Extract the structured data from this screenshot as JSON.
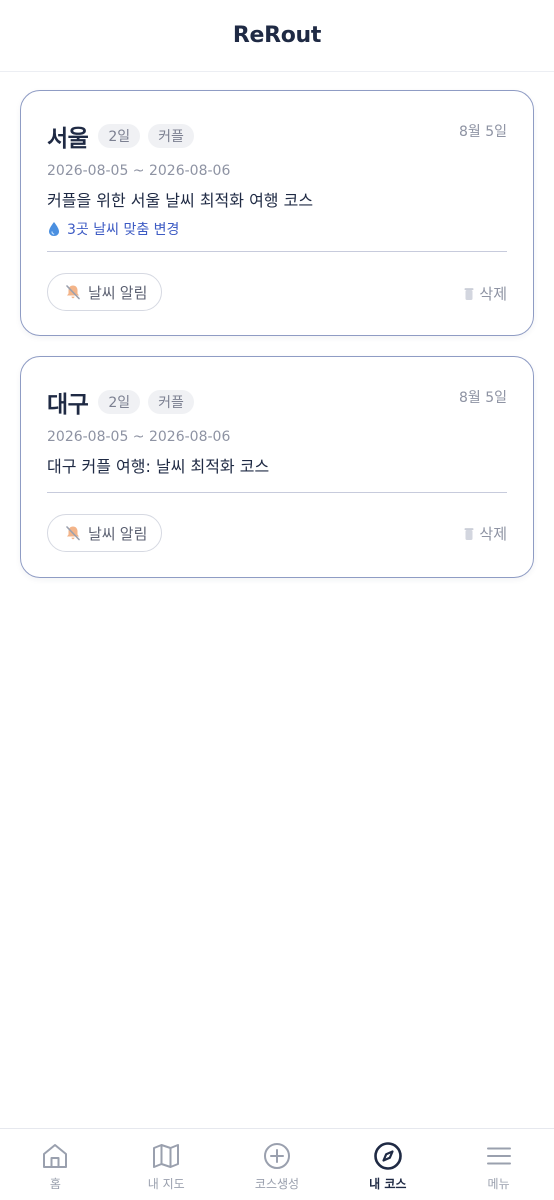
{
  "header": {
    "title": "ReRout"
  },
  "courses": [
    {
      "city": "서울",
      "days_tag": "2일",
      "theme_tag": "커플",
      "created": "8월 5일",
      "dates": "2026-08-05 ~ 2026-08-06",
      "title": "커플을 위한 서울 날씨 최적화 여행 코스",
      "weather_note": "3곳 날씨 맞춤 변경",
      "alert_label": "날씨 알림",
      "delete_label": "삭제"
    },
    {
      "city": "대구",
      "days_tag": "2일",
      "theme_tag": "커플",
      "created": "8월 5일",
      "dates": "2026-08-05 ~ 2026-08-06",
      "title": "대구 커플 여행: 날씨 최적화 코스",
      "alert_label": "날씨 알림",
      "delete_label": "삭제"
    }
  ],
  "bottom_nav": {
    "items": [
      {
        "label": "홈",
        "icon": "home-icon"
      },
      {
        "label": "내 지도",
        "icon": "map-icon"
      },
      {
        "label": "코스생성",
        "icon": "plus-circle-icon"
      },
      {
        "label": "내 코스",
        "icon": "compass-icon",
        "active": true
      },
      {
        "label": "메뉴",
        "icon": "menu-icon"
      }
    ]
  },
  "colors": {
    "primary": "#1f2a44",
    "accent_blue": "#3d5bc4",
    "card_border": "#8f9cc4",
    "muted": "#8e93a3"
  }
}
